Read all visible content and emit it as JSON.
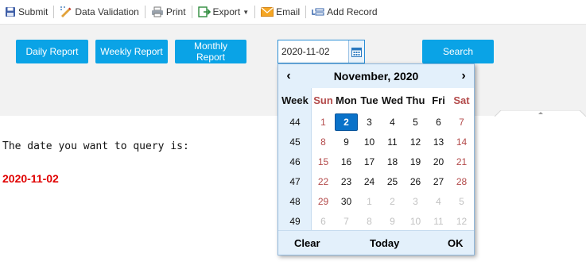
{
  "toolbar": {
    "submit": "Submit",
    "data_validation": "Data Validation",
    "print": "Print",
    "export": "Export",
    "email": "Email",
    "add_record": "Add Record"
  },
  "buttons": {
    "daily": "Daily Report",
    "weekly": "Weekly Report",
    "monthly": "Monthly Report",
    "search": "Search"
  },
  "date_input": {
    "value": "2020-11-02"
  },
  "query": {
    "label": "The date you want to query is:",
    "value": "2020-11-02"
  },
  "calendar": {
    "prev": "‹",
    "next": "›",
    "title": "November, 2020",
    "week_header": "Week",
    "day_headers": [
      "Sun",
      "Mon",
      "Tue",
      "Wed",
      "Thu",
      "Fri",
      "Sat"
    ],
    "rows": [
      {
        "week": "44",
        "days": [
          "1",
          "2",
          "3",
          "4",
          "5",
          "6",
          "7"
        ]
      },
      {
        "week": "45",
        "days": [
          "8",
          "9",
          "10",
          "11",
          "12",
          "13",
          "14"
        ]
      },
      {
        "week": "46",
        "days": [
          "15",
          "16",
          "17",
          "18",
          "19",
          "20",
          "21"
        ]
      },
      {
        "week": "47",
        "days": [
          "22",
          "23",
          "24",
          "25",
          "26",
          "27",
          "28"
        ]
      },
      {
        "week": "48",
        "days": [
          "29",
          "30",
          "1",
          "2",
          "3",
          "4",
          "5"
        ]
      },
      {
        "week": "49",
        "days": [
          "6",
          "7",
          "8",
          "9",
          "10",
          "11",
          "12"
        ]
      }
    ],
    "selected_day": "2",
    "clear": "Clear",
    "today": "Today",
    "ok": "OK"
  },
  "colors": {
    "button": "#0aa3e6",
    "selected": "#0a72c9",
    "weekend": "#b34a4a",
    "query_value": "#e00000"
  }
}
